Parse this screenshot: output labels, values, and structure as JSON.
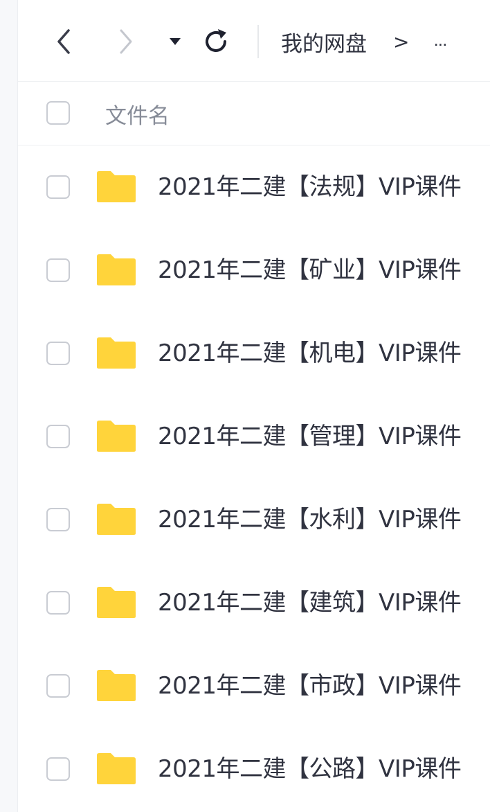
{
  "toolbar": {
    "back_icon": "chevron-left-icon",
    "forward_icon": "chevron-right-icon",
    "dropdown_icon": "caret-down-icon",
    "refresh_icon": "refresh-icon"
  },
  "breadcrumb": {
    "root": "我的网盘",
    "separator": ">",
    "more": "..."
  },
  "list_header": {
    "name_column": "文件名"
  },
  "files": [
    {
      "name": "2021年二建【法规】VIP课件",
      "icon": "folder-icon"
    },
    {
      "name": "2021年二建【矿业】VIP课件",
      "icon": "folder-icon"
    },
    {
      "name": "2021年二建【机电】VIP课件",
      "icon": "folder-icon"
    },
    {
      "name": "2021年二建【管理】VIP课件",
      "icon": "folder-icon"
    },
    {
      "name": "2021年二建【水利】VIP课件",
      "icon": "folder-icon"
    },
    {
      "name": "2021年二建【建筑】VIP课件",
      "icon": "folder-icon"
    },
    {
      "name": "2021年二建【市政】VIP课件",
      "icon": "folder-icon"
    },
    {
      "name": "2021年二建【公路】VIP课件",
      "icon": "folder-icon"
    }
  ],
  "colors": {
    "folder": "#FFD43B",
    "text": "#303340",
    "muted": "#878C98",
    "icon": "#3A3D4A",
    "icon_disabled": "#C4C7CE",
    "checkbox_border": "#C9CCD3"
  }
}
